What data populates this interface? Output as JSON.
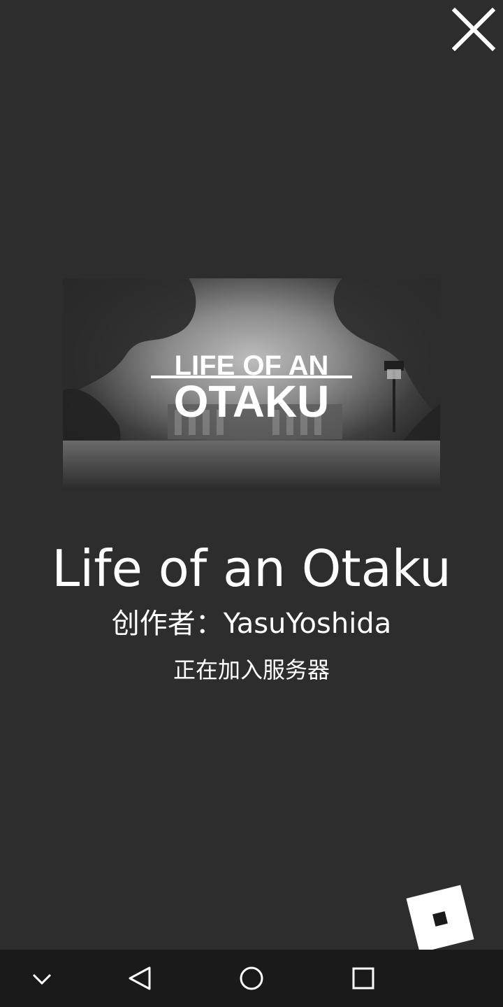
{
  "game": {
    "title": "Life of an Otaku",
    "creator_line": "创作者：YasuYoshida",
    "status": "正在加入服务器",
    "thumbnail": {
      "logo_line1": "LIFE OF AN",
      "logo_line2": "OTAKU"
    }
  },
  "icons": {
    "close": "close-icon",
    "logo": "roblox-logo-icon",
    "nav": [
      "chevron-down-icon",
      "back-triangle-icon",
      "home-circle-icon",
      "recents-square-icon"
    ]
  },
  "colors": {
    "background": "#2d2d2d",
    "navbar": "#1a1a1a",
    "text": "#ffffff"
  }
}
